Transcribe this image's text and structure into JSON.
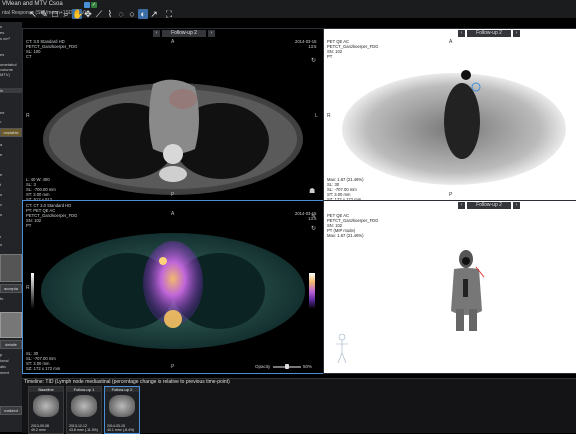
{
  "window": {
    "title": "VMean and MTV Csoa",
    "subtitle": "ntal Response (SUVmean+1SD/MTV)"
  },
  "toolbar": {
    "icons": [
      "cursor-icon",
      "pen-icon",
      "square-icon",
      "zoom-icon",
      "hand-icon",
      "move-icon",
      "line-icon",
      "polyline-icon",
      "lasso-icon",
      "circle-icon",
      "contrast-icon",
      "arrow-icon",
      "fullscreen-icon"
    ]
  },
  "left_panel": {
    "items": [
      "s",
      "es",
      "s cm³",
      "es",
      "ometabol",
      "volume",
      "MTV)",
      "le",
      "ne",
      "³",
      "ceptable",
      "a",
      "e",
      "e",
      "t",
      "n",
      "v",
      "s",
      "r",
      "n",
      "fo",
      "p",
      "ional",
      "atic",
      "ment",
      "ding",
      "detaile",
      "s"
    ],
    "buttons": [
      "accepta",
      "detaile",
      "malized"
    ]
  },
  "viewports": {
    "ct_top": {
      "tab": "Follow-up 2",
      "info_left": "CT: 3.0 Standard HD\nPETCT_Ganzkoerper_FDG\nSL: 100\nCT",
      "info_right": "2014-03-15\n13:5",
      "wl": "L: 40 W: 400\nSL: 3\nSL: -700.00 mm\nST: 3.00 mm\nSZ: 512 x 512",
      "orient_top": "A",
      "orient_left": "R",
      "orient_right": "L",
      "orient_bottom": "P"
    },
    "pet_top": {
      "tab": "Follow-up 2",
      "info_left": "PET QE AC\nPETCT_Ganzkoerper_FDG\nSN: 102\nPT",
      "info_lower": "Max: 1.67 (21.46%)\nSL: 30\nSL: -707.00 mm\nST: 3.00 mm\nSZ: 172 x 172 mm",
      "orient_top": "A",
      "orient_left": "R",
      "orient_bottom": "P"
    },
    "fusion": {
      "info_left": "CT: CT 3.0 Standard HD\nPT: PET QE AC\nPETCT_Ganzkoerper_FDG\nSN: 102\nPT",
      "info_right": "2014-03-15\n13:5",
      "wl": "SL: 30\nSL: -707.00 mm\nST: 3.00 mm\nSZ: 172 x 172 mm",
      "orient_top": "A",
      "orient_left": "R",
      "orient_bottom": "P",
      "opacity_label": "Opacity",
      "opacity_value": "50%",
      "opacity": 0.5
    },
    "mip": {
      "tab": "Follow-up 2",
      "info_left": "PET QE AC\nPETCT_Ganzkoerper_FDG\nSN: 102\nPT (MIP mode)\nMax: 1.67 (21.46%)"
    }
  },
  "timeline": {
    "header": "Timeline: TID (Lymph node mediastinal (percentage change is relative to previous time-point)",
    "thumbs": [
      {
        "label": "Baseline",
        "info": "2013-09-08\n49.2 mm³"
      },
      {
        "label": "Follow-up 1",
        "info": "2013-12-12\n43.8 mm³ (-11.0%)"
      },
      {
        "label": "Follow-up 2",
        "info": "2014-03-15\n40.1 mm³ (-8.4%)"
      }
    ]
  },
  "colors": {
    "accent": "#4a90d9",
    "panel": "#232427",
    "background": "#000000"
  }
}
